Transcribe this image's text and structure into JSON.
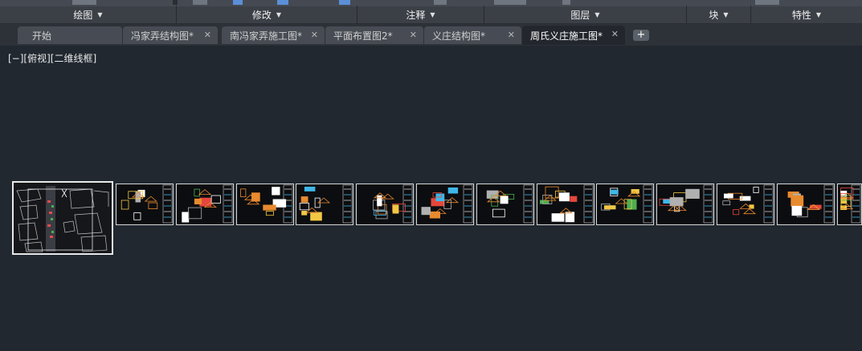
{
  "ribbon": {
    "panels": [
      {
        "label": "绘图"
      },
      {
        "label": "修改"
      },
      {
        "label": "注释"
      },
      {
        "label": "图层"
      },
      {
        "label": "块"
      },
      {
        "label": "特性"
      }
    ],
    "caret_glyph": "▼"
  },
  "tabs": [
    {
      "label": "开始",
      "closable": false,
      "active": false
    },
    {
      "label": "冯家弄结构图*",
      "closable": true,
      "active": false
    },
    {
      "label": "南冯家弄施工图*",
      "closable": true,
      "active": false
    },
    {
      "label": "平面布置图2*",
      "closable": true,
      "active": false
    },
    {
      "label": "义庄结构图*",
      "closable": true,
      "active": false
    },
    {
      "label": "周氏义庄施工图*",
      "closable": true,
      "active": true
    }
  ],
  "close_glyph": "✕",
  "new_tab_glyph": "+",
  "viewport": {
    "label": "[−][俯视][二维线框]"
  },
  "colors": {
    "background": "#212830",
    "ribbon": "#3b3f46",
    "tab_active": "#23272d",
    "tab_inactive": "#474c54"
  }
}
